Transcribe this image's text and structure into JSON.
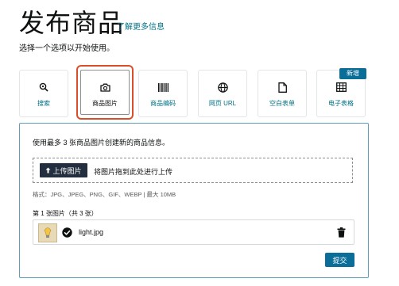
{
  "header": {
    "title": "发布商品",
    "learn_more": "了解更多信息",
    "subtitle": "选择一个选项以开始使用。"
  },
  "options": [
    {
      "label": "搜索",
      "icon": "search-icon"
    },
    {
      "label": "商品图片",
      "icon": "camera-icon",
      "selected": true
    },
    {
      "label": "商品编码",
      "icon": "barcode-icon"
    },
    {
      "label": "网页 URL",
      "icon": "globe-icon"
    },
    {
      "label": "空白表单",
      "icon": "document-icon"
    },
    {
      "label": "电子表格",
      "icon": "spreadsheet-icon",
      "badge": "新增"
    }
  ],
  "upload": {
    "description": "使用最多 3 张商品图片创建新的商品信息。",
    "button_label": "上传图片",
    "drop_text": "将图片拖到此处进行上传",
    "formats": "格式：JPG、JPEG、PNG、GIF、WEBP | 最大 10MB",
    "count_text": "第 1 张图片（共 3 张）",
    "file_name": "light.jpg",
    "submit_label": "提交"
  },
  "colors": {
    "link": "#007185",
    "accent": "#0b6e99",
    "selected_outline": "#d94f2b",
    "button_dark": "#232f3e"
  }
}
